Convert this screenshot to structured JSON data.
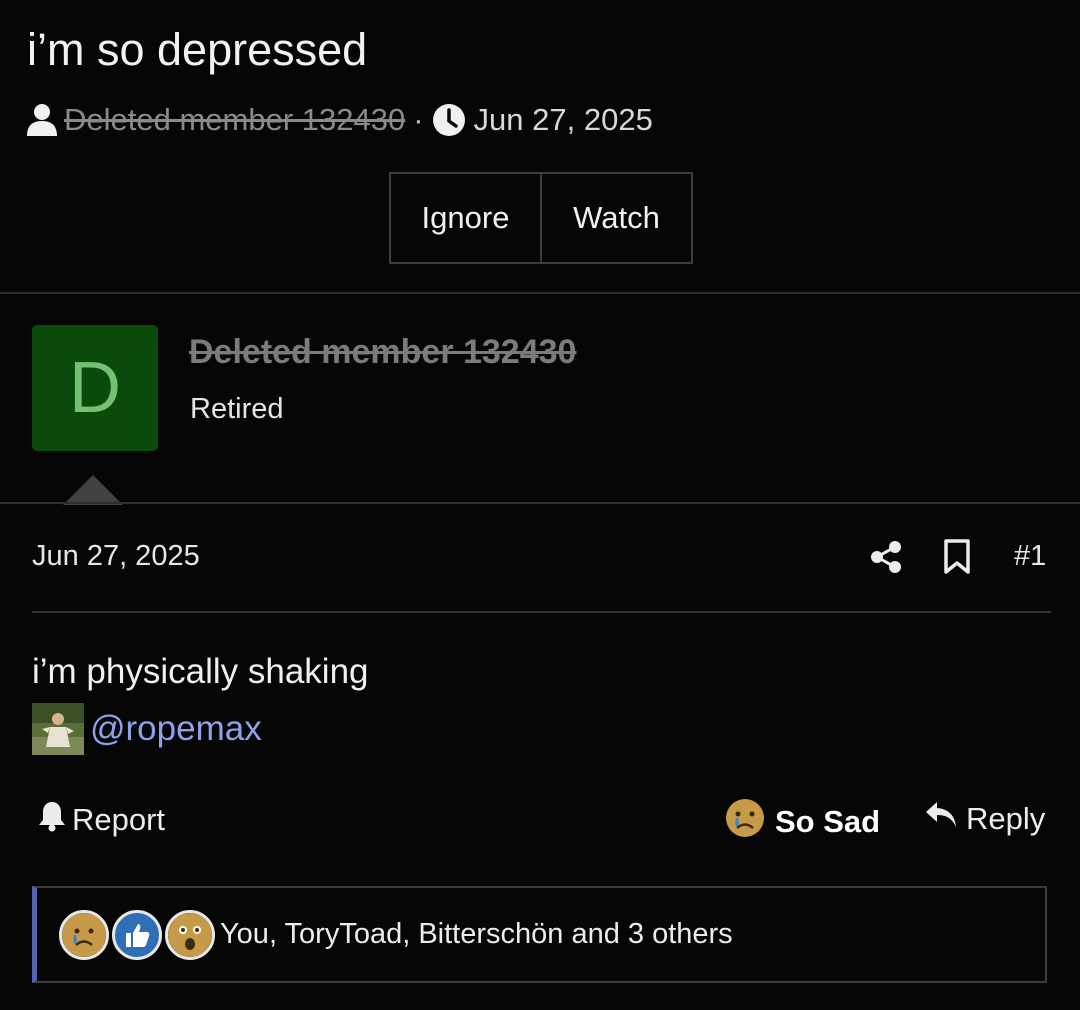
{
  "thread": {
    "title": "i’m so depressed",
    "author": "Deleted member 132430",
    "separator": "·",
    "date": "Jun 27, 2025",
    "buttons": {
      "ignore": "Ignore",
      "watch": "Watch"
    }
  },
  "post": {
    "avatar_letter": "D",
    "username": "Deleted member 132430",
    "user_title": "Retired",
    "date": "Jun 27, 2025",
    "number": "#1",
    "body_text": "i’m physically shaking",
    "mention": "@ropemax",
    "actions": {
      "report": "Report",
      "reaction": "So Sad",
      "reply": "Reply"
    },
    "reactions_summary": "You, ToryToad, Bitterschön and 3 others"
  },
  "colors": {
    "background": "#060606",
    "avatar_bg": "#0a4a0a",
    "avatar_letter": "#74c174",
    "mention": "#8fa1e8",
    "reactions_accent": "#5563b0"
  },
  "icons": [
    "user-icon",
    "clock-icon",
    "share-icon",
    "bookmark-icon",
    "bell-icon",
    "sad-emoji-icon",
    "reply-icon",
    "like-icon",
    "wow-icon"
  ]
}
